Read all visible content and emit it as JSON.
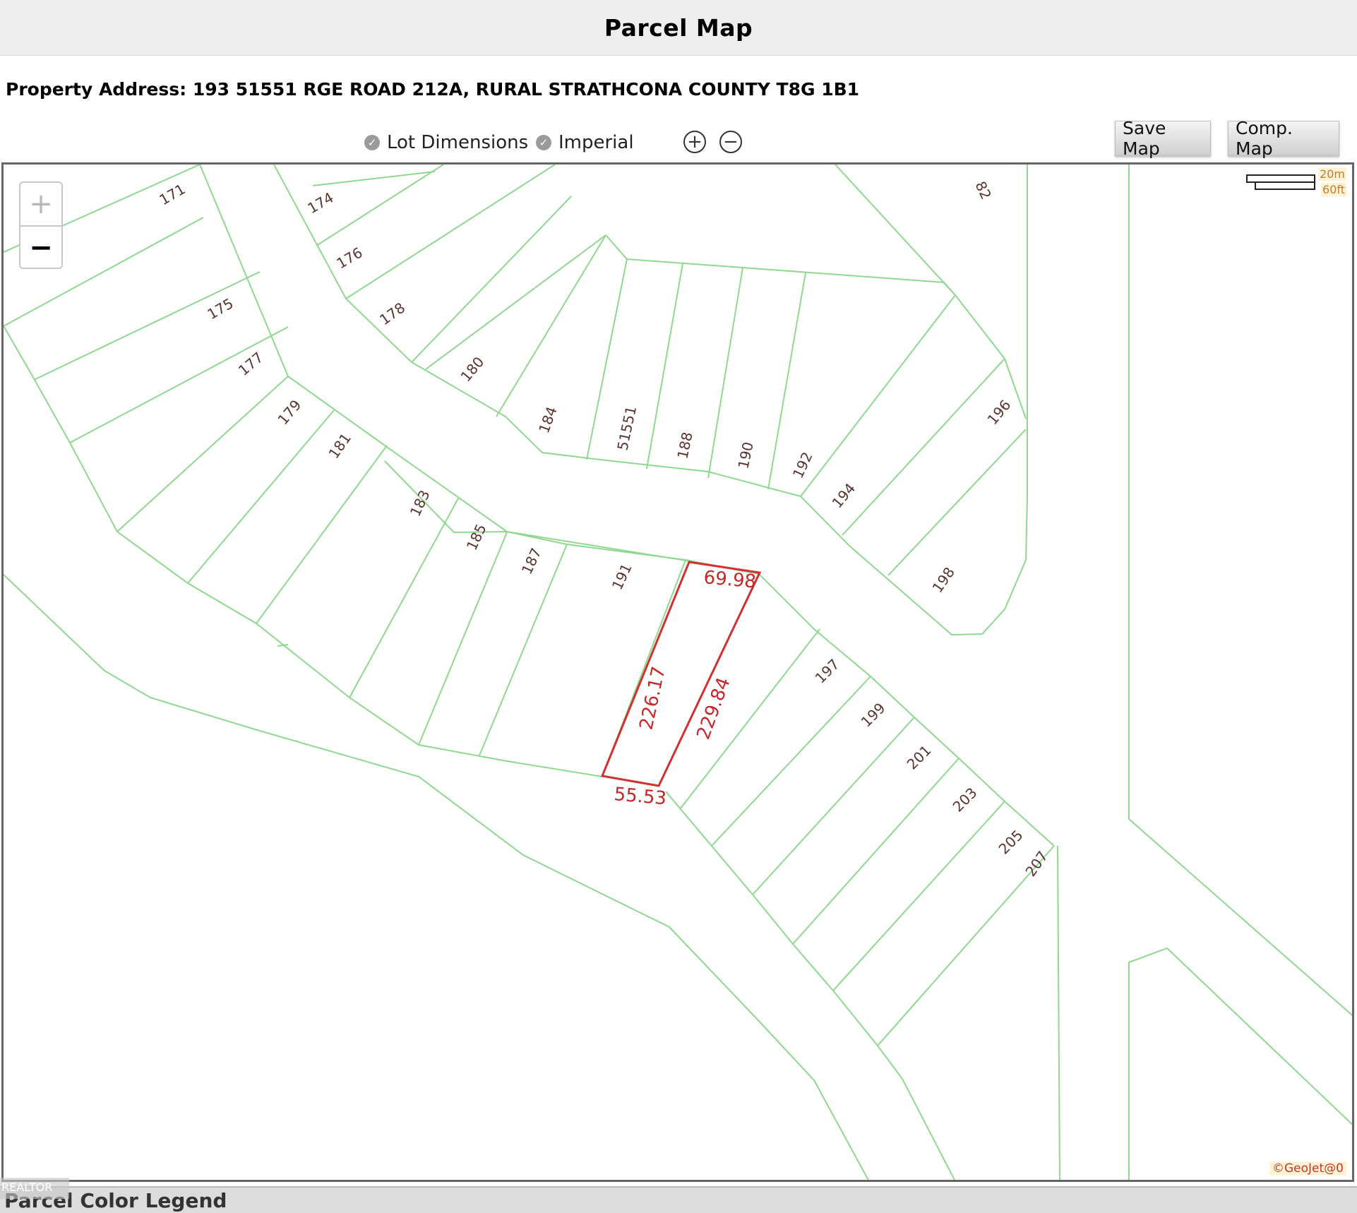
{
  "header": {
    "title": "Parcel Map"
  },
  "property": {
    "address": "Property Address: 193 51551 RGE ROAD 212A, RURAL STRATHCONA COUNTY T8G 1B1"
  },
  "toolbar": {
    "lot_dimensions_label": "Lot Dimensions",
    "lot_dimensions_checked": true,
    "imperial_label": "Imperial",
    "imperial_checked": true,
    "zoom_in_glyph": "+",
    "zoom_out_glyph": "−",
    "save_map_label": "Save Map",
    "comp_map_label": "Comp. Map"
  },
  "map": {
    "zoom_in": "+",
    "zoom_out": "−",
    "scale_metric": "20m",
    "scale_imperial": "60ft",
    "credit": "©GeoJet@0",
    "road_label_partial": "82",
    "lot_labels": [
      "171",
      "174",
      "176",
      "175",
      "178",
      "177",
      "180",
      "179",
      "181",
      "184",
      "51551",
      "188",
      "190",
      "192",
      "196",
      "194",
      "183",
      "185",
      "187",
      "191",
      "198",
      "197",
      "199",
      "201",
      "203",
      "205",
      "207"
    ],
    "subject_lot": {
      "front": "69.98",
      "back": "55.53",
      "left_side": "226.17",
      "right_side": "229.84"
    },
    "colors": {
      "lot_lines": "#8fd88f",
      "subject_outline": "#d32f2f"
    }
  },
  "legend": {
    "title": "Parcel Color Legend",
    "ghost_text": "REALTOR"
  }
}
